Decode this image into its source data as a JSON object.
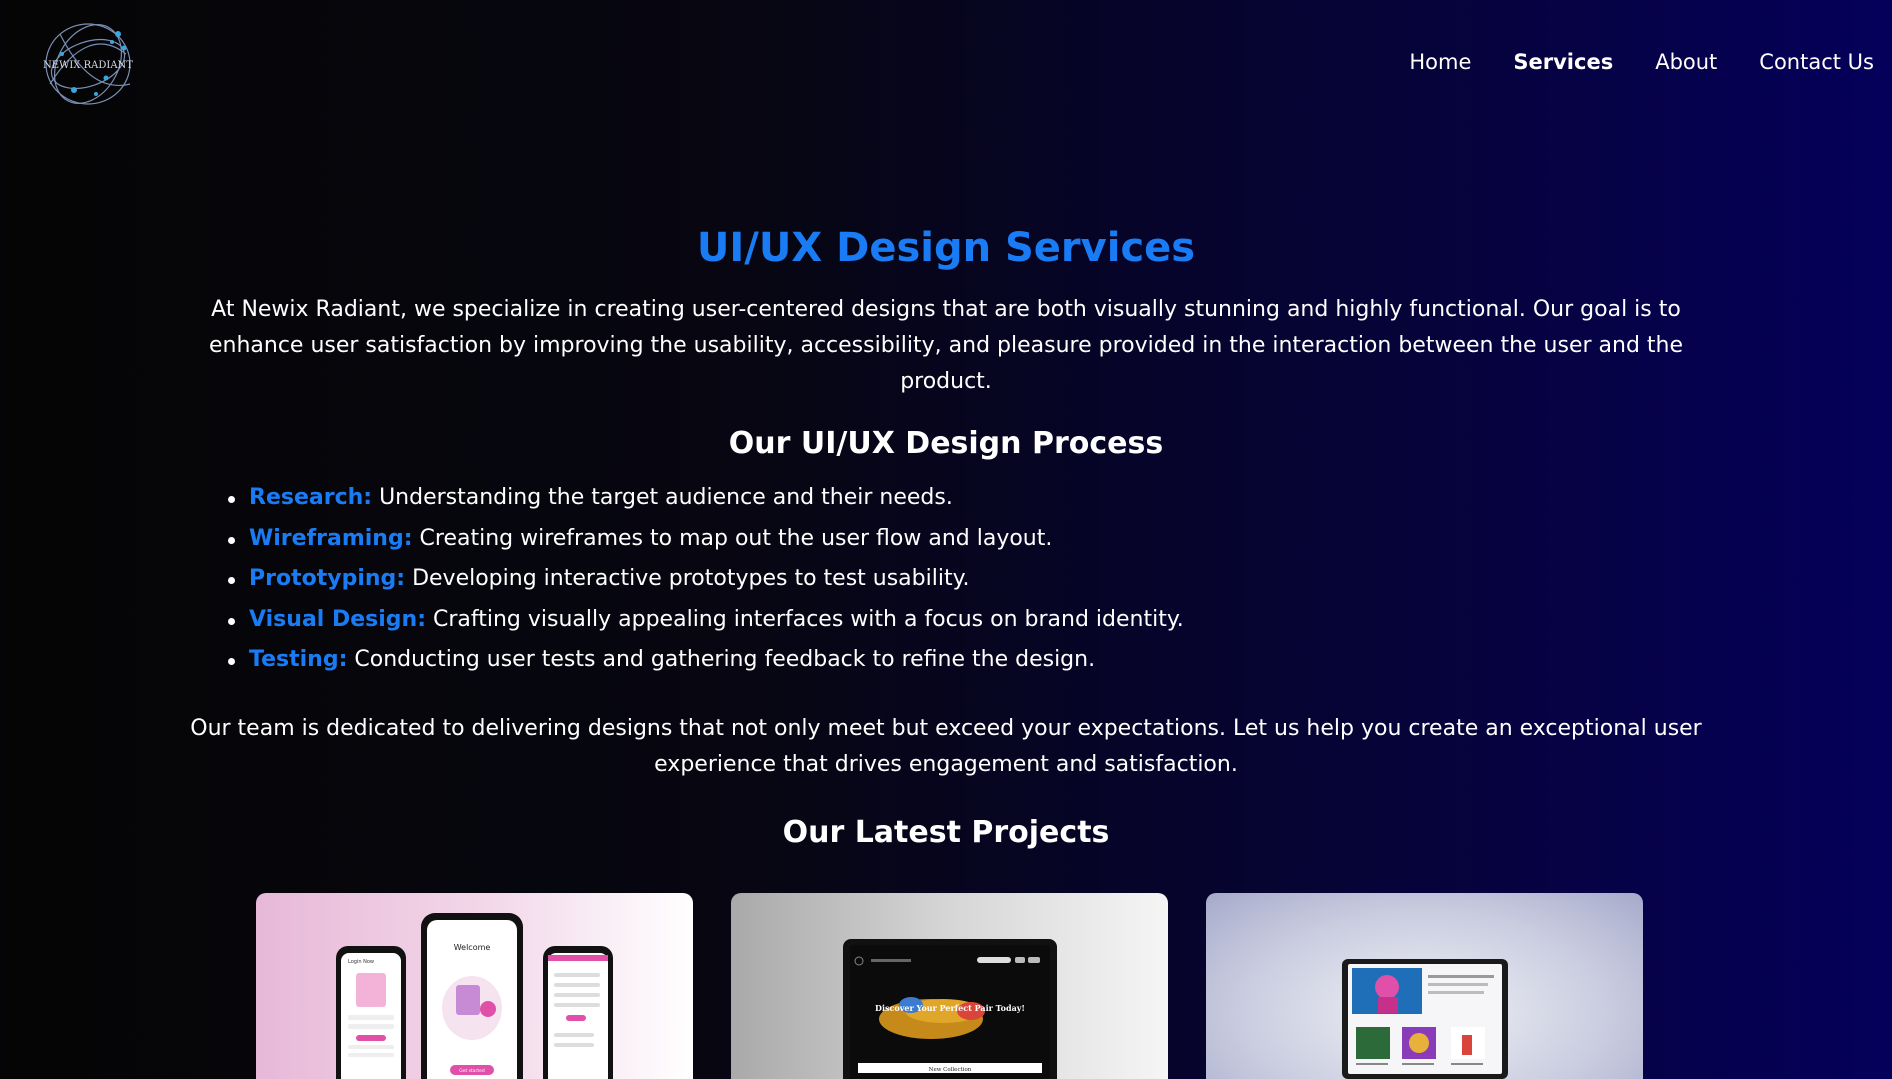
{
  "brand": {
    "logo_text": "NEWIX RADIANT"
  },
  "nav": {
    "items": [
      {
        "label": "Home"
      },
      {
        "label": "Services",
        "active": true
      },
      {
        "label": "About"
      },
      {
        "label": "Contact Us"
      }
    ]
  },
  "main": {
    "title": "UI/UX Design Services",
    "intro": "At Newix Radiant, we specialize in creating user-centered designs that are both visually stunning and highly functional. Our goal is to enhance user satisfaction by improving the usability, accessibility, and pleasure provided in the interaction between the user and the product.",
    "process_heading": "Our UI/UX Design Process",
    "steps": [
      {
        "term": "Research:",
        "text": " Understanding the target audience and their needs."
      },
      {
        "term": "Wireframing:",
        "text": " Creating wireframes to map out the user flow and layout."
      },
      {
        "term": "Prototyping:",
        "text": " Developing interactive prototypes to test usability."
      },
      {
        "term": "Visual Design:",
        "text": " Crafting visually appealing interfaces with a focus on brand identity."
      },
      {
        "term": "Testing:",
        "text": " Conducting user tests and gathering feedback to refine the design."
      }
    ],
    "outro": "Our team is dedicated to delivering designs that not only meet but exceed your expectations. Let us help you create an exceptional user experience that drives engagement and satisfaction.",
    "projects_heading": "Our Latest Projects"
  },
  "projects": [
    {
      "screen_labels": [
        "Login Now",
        "Welcome",
        "Get started"
      ]
    },
    {
      "screen_labels": [
        "Discover Your Perfect Pair Today!",
        "New Collection"
      ]
    },
    {
      "screen_labels": []
    }
  ],
  "colors": {
    "accent": "#1a7cf5",
    "text": "#ffffff",
    "bg_left": "#050505",
    "bg_right": "#05005a"
  }
}
